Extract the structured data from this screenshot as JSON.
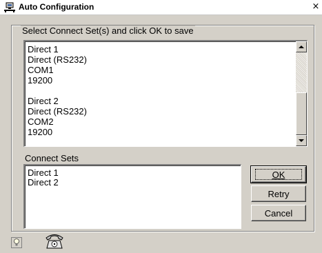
{
  "window": {
    "title": "Auto Configuration",
    "close_glyph": "×"
  },
  "group": {
    "legend": "Select Connect Set(s) and click OK to save"
  },
  "details_list": {
    "entries": [
      {
        "name": "Direct 1",
        "type": "Direct (RS232)",
        "port": "COM1",
        "baud": "19200"
      },
      {
        "name": "Direct 2",
        "type": "Direct (RS232)",
        "port": "COM2",
        "baud": "19200"
      }
    ]
  },
  "connect_sets": {
    "label": "Connect Sets",
    "items": [
      "Direct 1",
      "Direct 2"
    ]
  },
  "buttons": {
    "ok": "OK",
    "retry": "Retry",
    "cancel": "Cancel"
  },
  "icons": {
    "title": "network-computer-icon",
    "status_left": "lightbulb-icon",
    "status_right": "telephone-icon"
  }
}
